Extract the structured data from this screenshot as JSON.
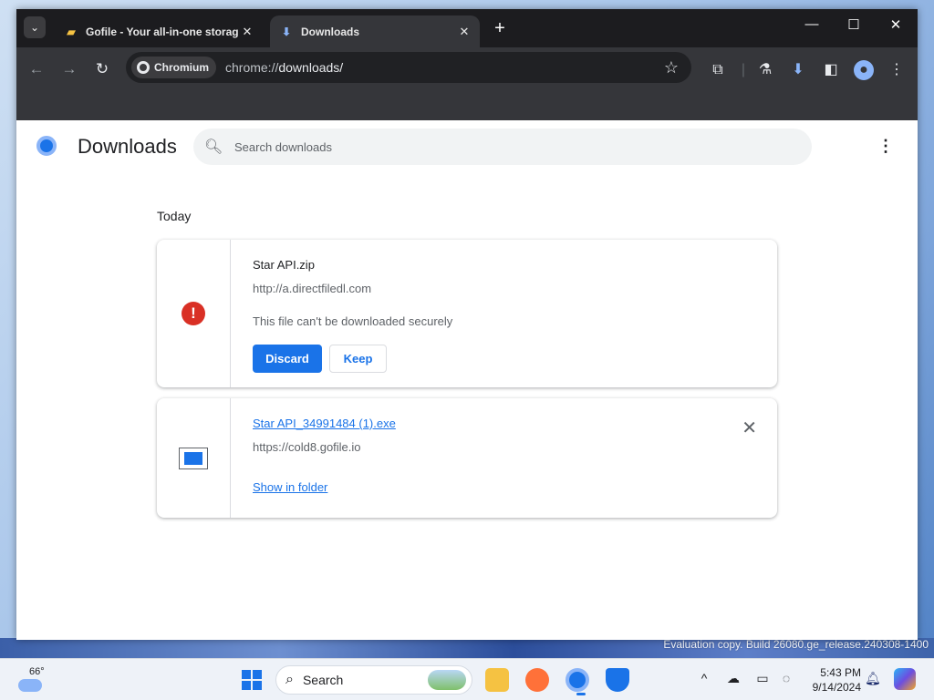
{
  "browser": {
    "tabs": [
      {
        "title": "Gofile - Your all-in-one storage",
        "favicon": "gofile-icon",
        "active": false
      },
      {
        "title": "Downloads",
        "favicon": "download-icon",
        "active": true
      }
    ],
    "omnibox": {
      "chip_label": "Chromium",
      "url_prefix": "chrome://",
      "url_path": "downloads/"
    }
  },
  "page": {
    "title": "Downloads",
    "search_placeholder": "Search downloads",
    "section_label": "Today",
    "items": [
      {
        "file_name": "Star API.zip",
        "source_url": "http://a.directfiledl.com",
        "warning": "This file can't be downloaded securely",
        "discard_label": "Discard",
        "keep_label": "Keep",
        "status": "insecure-blocked"
      },
      {
        "file_name": "Star API_34991484 (1).exe",
        "source_url": "https://cold8.gofile.io",
        "show_in_folder_label": "Show in folder",
        "status": "complete"
      }
    ]
  },
  "desktop": {
    "watermark": "Evaluation copy. Build 26080.ge_release.240308-1400"
  },
  "taskbar": {
    "weather_temp": "66°",
    "search_label": "Search",
    "clock_time": "5:43 PM",
    "clock_date": "9/14/2024"
  },
  "colors": {
    "accent": "#1a73e8",
    "error": "#d93025",
    "tabstrip": "#1c1c1f",
    "toolbar": "#35363a"
  }
}
